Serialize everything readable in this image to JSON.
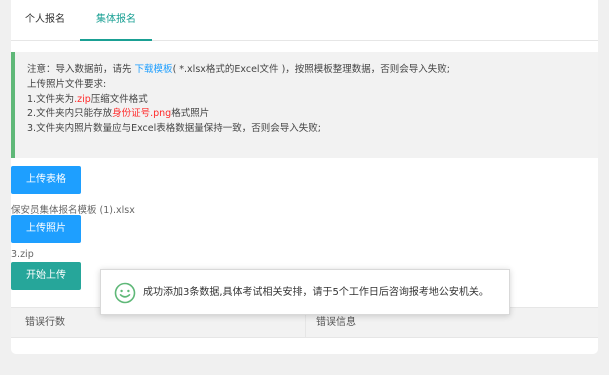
{
  "tabs": [
    "个人报名",
    "集体报名"
  ],
  "notice": {
    "line1_prefix": "注意：导入数据前，请先",
    "line1_link": "下载模板",
    "line1_suffix": "( *.xlsx格式的Excel文件 )，按照模板整理数据，否则会导入失败;",
    "line2": "上传照片文件要求:",
    "line3_prefix": "1.文件夹为",
    "line3_red": ".zip",
    "line3_suffix": "压缩文件格式",
    "line4_prefix": "2.文件夹内只能存放",
    "line4_red": "身份证号.png",
    "line4_suffix": "格式照片",
    "line5": "3.文件夹内照片数量应与Excel表格数据量保持一致，否则会导入失败;"
  },
  "buttons": {
    "upload_sheet": "上传表格",
    "upload_photo": "上传照片",
    "start_upload": "开始上传"
  },
  "files": {
    "sheet": "保安员集体报名模板 (1).xlsx",
    "zip": "3.zip"
  },
  "table": {
    "headers": [
      "错误行数",
      "错误信息"
    ]
  },
  "toast": {
    "message": "成功添加3条数据,具体考试相关安排，请于5个工作日后咨询报考地公安机关。"
  },
  "colors": {
    "accent_green": "#1aa094",
    "link_blue": "#1e9fff",
    "button_green": "#26a69a",
    "highlight_red": "#ff2a2a"
  }
}
